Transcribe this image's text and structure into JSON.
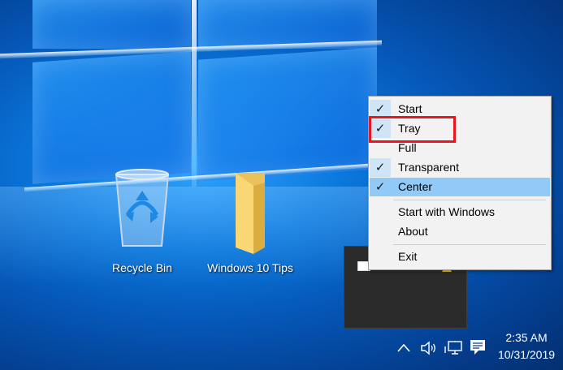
{
  "desktop": {
    "icons": [
      {
        "label": "Recycle Bin",
        "icon": "recycle-bin-icon"
      },
      {
        "label": "Windows 10 Tips",
        "icon": "folder-icon"
      }
    ]
  },
  "context_menu": {
    "items": [
      {
        "label": "Start",
        "checked": true
      },
      {
        "label": "Tray",
        "checked": true,
        "emphasized": true
      },
      {
        "label": "Full",
        "checked": false
      },
      {
        "label": "Transparent",
        "checked": true
      },
      {
        "label": "Center",
        "checked": true,
        "hovered": true
      },
      {
        "label": "Start with Windows",
        "checked": false
      },
      {
        "label": "About",
        "checked": false
      },
      {
        "label": "Exit",
        "checked": false
      }
    ],
    "check_glyph": "✓"
  },
  "tray": {
    "icons": [
      "chevron-up-icon",
      "volume-icon",
      "network-icon",
      "notification-icon"
    ],
    "overflow_icons": [
      "app-tray-icon",
      "warning-icon"
    ],
    "time": "2:35 AM",
    "date": "10/31/2019"
  },
  "colors": {
    "highlight_border": "#e8171f",
    "menu_hover": "#91c9f7"
  }
}
